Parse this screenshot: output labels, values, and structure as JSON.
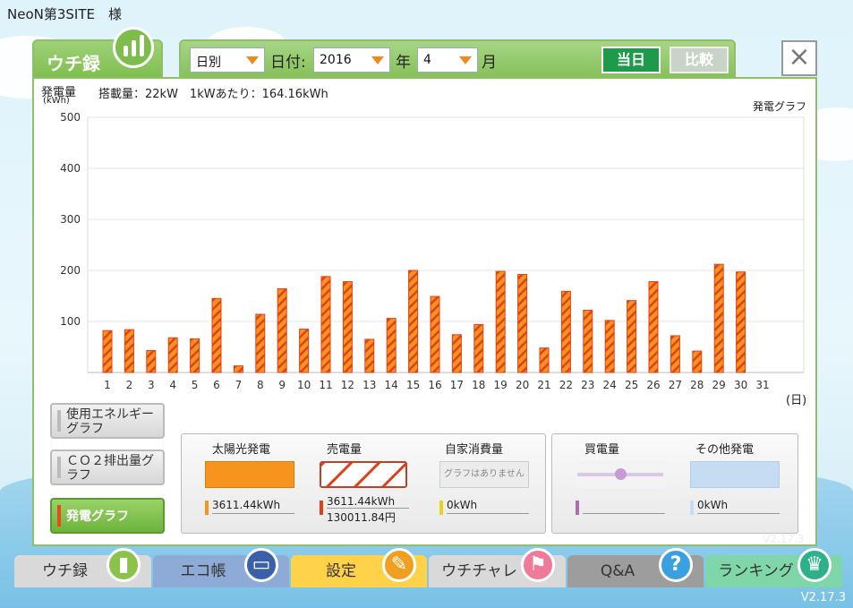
{
  "site_title": "NeoN第3SITE　様",
  "version": "V2.17.3",
  "version_ghost": "V2.17.3",
  "tab": {
    "label": "ウチ録"
  },
  "controls": {
    "mode": "日別",
    "date_label": "日付:",
    "year_value": "2016",
    "year_label": "年",
    "month_value": "4",
    "month_label": "月",
    "today_button": "当日",
    "compare_button": "比較"
  },
  "close_label": "×",
  "panel": {
    "heading": "発電量",
    "unit": "(kWh)",
    "info": "搭載量：22kW　1kWあたり：164.16kWh",
    "graph_title": "発電グラフ",
    "x_unit": "(日)"
  },
  "colors": {
    "bar_fill": "#f7941d",
    "bar_stripe": "#e0401a",
    "accent_green": "#7cbd4c"
  },
  "chart_data": {
    "type": "bar",
    "title": "発電グラフ",
    "ylabel": "発電量 (kWh)",
    "xlabel": "(日)",
    "ylim": [
      0,
      500
    ],
    "yticks": [
      100,
      200,
      300,
      400,
      500
    ],
    "categories": [
      "1",
      "2",
      "3",
      "4",
      "5",
      "6",
      "7",
      "8",
      "9",
      "10",
      "11",
      "12",
      "13",
      "14",
      "15",
      "16",
      "17",
      "18",
      "19",
      "20",
      "21",
      "22",
      "23",
      "24",
      "25",
      "26",
      "27",
      "28",
      "29",
      "30",
      "31"
    ],
    "values": [
      82,
      84,
      43,
      68,
      66,
      145,
      13,
      114,
      164,
      85,
      188,
      178,
      65,
      106,
      200,
      149,
      74,
      94,
      198,
      192,
      48,
      159,
      122,
      102,
      141,
      178,
      72,
      42,
      212,
      197,
      0
    ],
    "grid": true
  },
  "side_buttons": [
    {
      "label": "使用エネルギーグラフ"
    },
    {
      "label": "ＣＯ２排出量グラフ"
    },
    {
      "label": "発電グラフ"
    }
  ],
  "legend": {
    "solar": {
      "name": "太陽光発電",
      "value": "3611.44kWh"
    },
    "sold": {
      "name": "売電量",
      "value": "3611.44kWh",
      "value2": "130011.84円"
    },
    "self": {
      "name": "自家消費量",
      "note": "グラフはありません",
      "value": "0kWh"
    },
    "bought": {
      "name": "買電量"
    },
    "other": {
      "name": "その他発電",
      "value": "0kWh"
    }
  },
  "nav": [
    {
      "label": "ウチ録",
      "color": "#8bc34a",
      "bg": "#d9d9d9",
      "icon": "bar-chart-icon"
    },
    {
      "label": "エコ帳",
      "color": "#3b5fa8",
      "bg": "#8eaad6",
      "icon": "notebook-icon"
    },
    {
      "label": "設定",
      "color": "#f0a020",
      "bg": "#ffd24a",
      "icon": "wrench-icon"
    },
    {
      "label": "ウチチャレ",
      "color": "#f07a9a",
      "bg": "#d9d9d9",
      "icon": "flag-icon"
    },
    {
      "label": "Q&A",
      "color": "#3aa0e0",
      "bg": "#9d9d9d",
      "icon": "question-icon"
    },
    {
      "label": "ランキング",
      "color": "#2eb08a",
      "bg": "#7fd6a8",
      "icon": "crown-icon"
    }
  ]
}
